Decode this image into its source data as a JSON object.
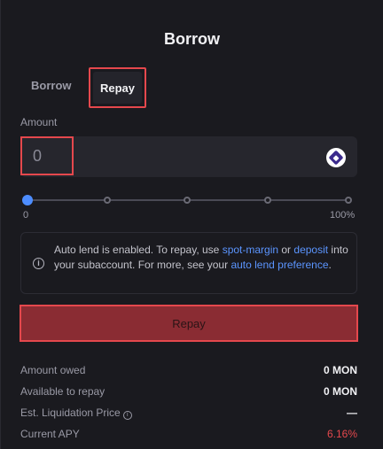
{
  "title": "Borrow",
  "tabs": [
    {
      "label": "Borrow"
    },
    {
      "label": "Repay"
    }
  ],
  "amount": {
    "label": "Amount",
    "value": "0"
  },
  "token": {
    "icon": "monad-token-icon"
  },
  "slider": {
    "min_label": "0",
    "max_label": "100%",
    "value_percent": 0,
    "steps": [
      0,
      25,
      50,
      75,
      100
    ]
  },
  "notice": {
    "text_1": "Auto lend is enabled. To repay, use ",
    "link_1": "spot-margin",
    "text_2": " or ",
    "link_2": "deposit",
    "text_3": " into your subaccount. For more, see your ",
    "link_3": "auto lend preference",
    "text_4": "."
  },
  "repay_button": {
    "label": "Repay"
  },
  "details": [
    {
      "label": "Amount owed",
      "value": "0 MON"
    },
    {
      "label": "Available to repay",
      "value": "0 MON"
    },
    {
      "label": "Est. Liquidation Price",
      "value": "—"
    },
    {
      "label": "Current APY",
      "value": "6.16%"
    }
  ],
  "colors": {
    "accent_blue": "#4d8dff",
    "highlight_red": "#e5484d",
    "repay_button_bg": "#8a2c33",
    "apy_red": "#e5484d"
  }
}
